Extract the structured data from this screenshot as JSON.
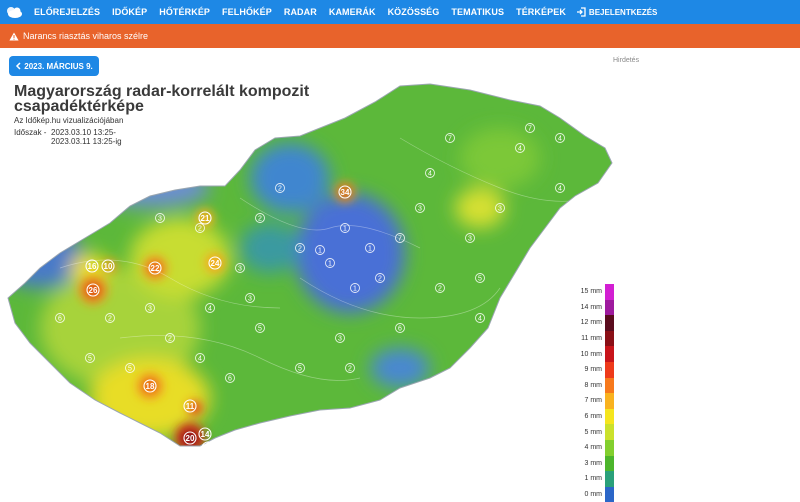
{
  "nav": {
    "items": [
      "ELŐREJELZÉS",
      "IDŐKÉP",
      "HŐTÉRKÉP",
      "FELHŐKÉP",
      "RADAR",
      "KAMERÁK",
      "KÖZÖSSÉG",
      "TEMATIKUS",
      "TÉRKÉPEK"
    ],
    "login": "BEJELENTKEZÉS"
  },
  "alert": {
    "text": "Narancs riasztás viharos szélre"
  },
  "date_button": "2023. MÁRCIUS 9.",
  "ad_label": "Hirdetés",
  "map": {
    "title": "Magyarország radar-korrelált kompozit csapadéktérképe",
    "subtitle": "Az Időkép.hu vizualizációjában",
    "period_label": "Időszak -",
    "period_from": "2023.03.10 13:25-",
    "period_to": "2023.03.11 13:25-ig"
  },
  "legend": [
    {
      "label": "15 mm",
      "color": "#d21fd2"
    },
    {
      "label": "14 mm",
      "color": "#9e1a9e"
    },
    {
      "label": "12 mm",
      "color": "#5a0c1e"
    },
    {
      "label": "11 mm",
      "color": "#8a0f16"
    },
    {
      "label": "10 mm",
      "color": "#c8141a"
    },
    {
      "label": "9 mm",
      "color": "#ee3a1a"
    },
    {
      "label": "8 mm",
      "color": "#f7791c"
    },
    {
      "label": "7 mm",
      "color": "#f9b21f"
    },
    {
      "label": "6 mm",
      "color": "#f5e51e"
    },
    {
      "label": "5 mm",
      "color": "#cbe12c"
    },
    {
      "label": "4 mm",
      "color": "#82cf2e"
    },
    {
      "label": "3 mm",
      "color": "#4cb52c"
    },
    {
      "label": "1 mm",
      "color": "#2aa07a"
    },
    {
      "label": "0 mm",
      "color": "#2b66c8"
    }
  ],
  "hotspots": [
    "26",
    "22",
    "24",
    "18",
    "11",
    "21",
    "34",
    "20",
    "14",
    "12",
    "10",
    "16"
  ],
  "stations": [
    "1",
    "1",
    "1",
    "2",
    "2",
    "2",
    "3",
    "3",
    "3",
    "4",
    "4",
    "4",
    "5",
    "5",
    "5",
    "6",
    "6",
    "7",
    "7",
    "3",
    "2",
    "1",
    "2",
    "4",
    "3",
    "5",
    "2",
    "3",
    "4",
    "1",
    "2",
    "6",
    "7",
    "4",
    "3",
    "2",
    "5",
    "4",
    "3",
    "2"
  ]
}
